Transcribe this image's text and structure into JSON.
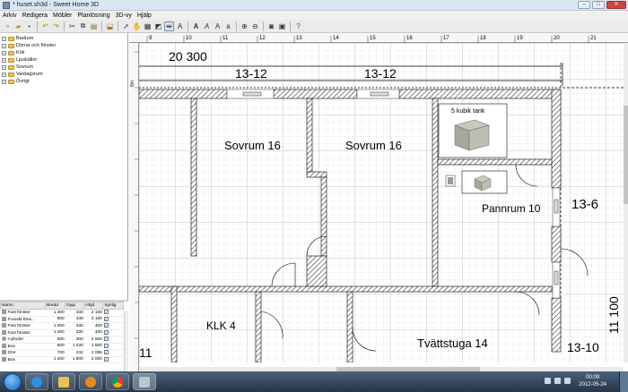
{
  "window": {
    "title": "* huset.sh3d - Sweet Home 3D",
    "buttons": [
      "–",
      "□",
      "✕"
    ]
  },
  "menu": [
    "Arkiv",
    "Redigera",
    "Möbler",
    "Planlösning",
    "3D-vy",
    "Hjälp"
  ],
  "catalog": [
    {
      "label": "Badrum"
    },
    {
      "label": "Dörrar och fönster"
    },
    {
      "label": "Kök"
    },
    {
      "label": "Ljuskällor"
    },
    {
      "label": "Sovrum"
    },
    {
      "label": "Vardagsrum"
    },
    {
      "label": "Övrigt"
    }
  ],
  "furniture": {
    "columns": [
      "Namn",
      "Bredd",
      "Djup",
      "Höjd",
      "Synlig"
    ],
    "rows": [
      {
        "name": "Fast fönster",
        "w": "1 300",
        "d": "330",
        "h": "2 100",
        "visible": true
      },
      {
        "name": "Franskt föns...",
        "w": "900",
        "d": "449",
        "h": "2 100",
        "visible": true
      },
      {
        "name": "Fast fönster",
        "w": "1 300",
        "d": "330",
        "h": "400",
        "visible": true
      },
      {
        "name": "Fast fönster",
        "w": "1 300",
        "d": "330",
        "h": "400",
        "visible": true
      },
      {
        "name": "Cylinder",
        "w": "300",
        "d": "300",
        "h": "2 500",
        "visible": true
      },
      {
        "name": "Box",
        "w": "600",
        "d": "1 230",
        "h": "1 500",
        "visible": true
      },
      {
        "name": "Dörr",
        "w": "700",
        "d": "232",
        "h": "2 085",
        "visible": true
      },
      {
        "name": "Box",
        "w": "1 400",
        "d": "1 800",
        "h": "2 000",
        "visible": true
      }
    ]
  },
  "ruler": {
    "h_ticks": [
      "9",
      "10",
      "11",
      "12",
      "13",
      "14",
      "15",
      "16",
      "17",
      "18",
      "19",
      "20",
      "21"
    ],
    "v_label": "8m"
  },
  "plan": {
    "dimensions": {
      "top_total": "20 300",
      "top_left": "13-12",
      "top_right": "13-12",
      "right_mid": "13-6",
      "right_vertical": "11 100",
      "right_bottom": "13-10",
      "left_bottom": "11"
    },
    "rooms": [
      {
        "label": "Sovrum 16"
      },
      {
        "label": "Sovrum 16"
      },
      {
        "label": "Pannrum 10"
      },
      {
        "label": "KLK 4"
      },
      {
        "label": "Tvättstuga 14"
      }
    ],
    "tank_label": "5 kubik tank"
  },
  "taskbar": {
    "time": "00:09",
    "date": "2012-05-24"
  },
  "colors": {
    "wall_hatch": "#333333",
    "grid": "#d6d6d6",
    "grid_major": "#a8a8a8"
  }
}
